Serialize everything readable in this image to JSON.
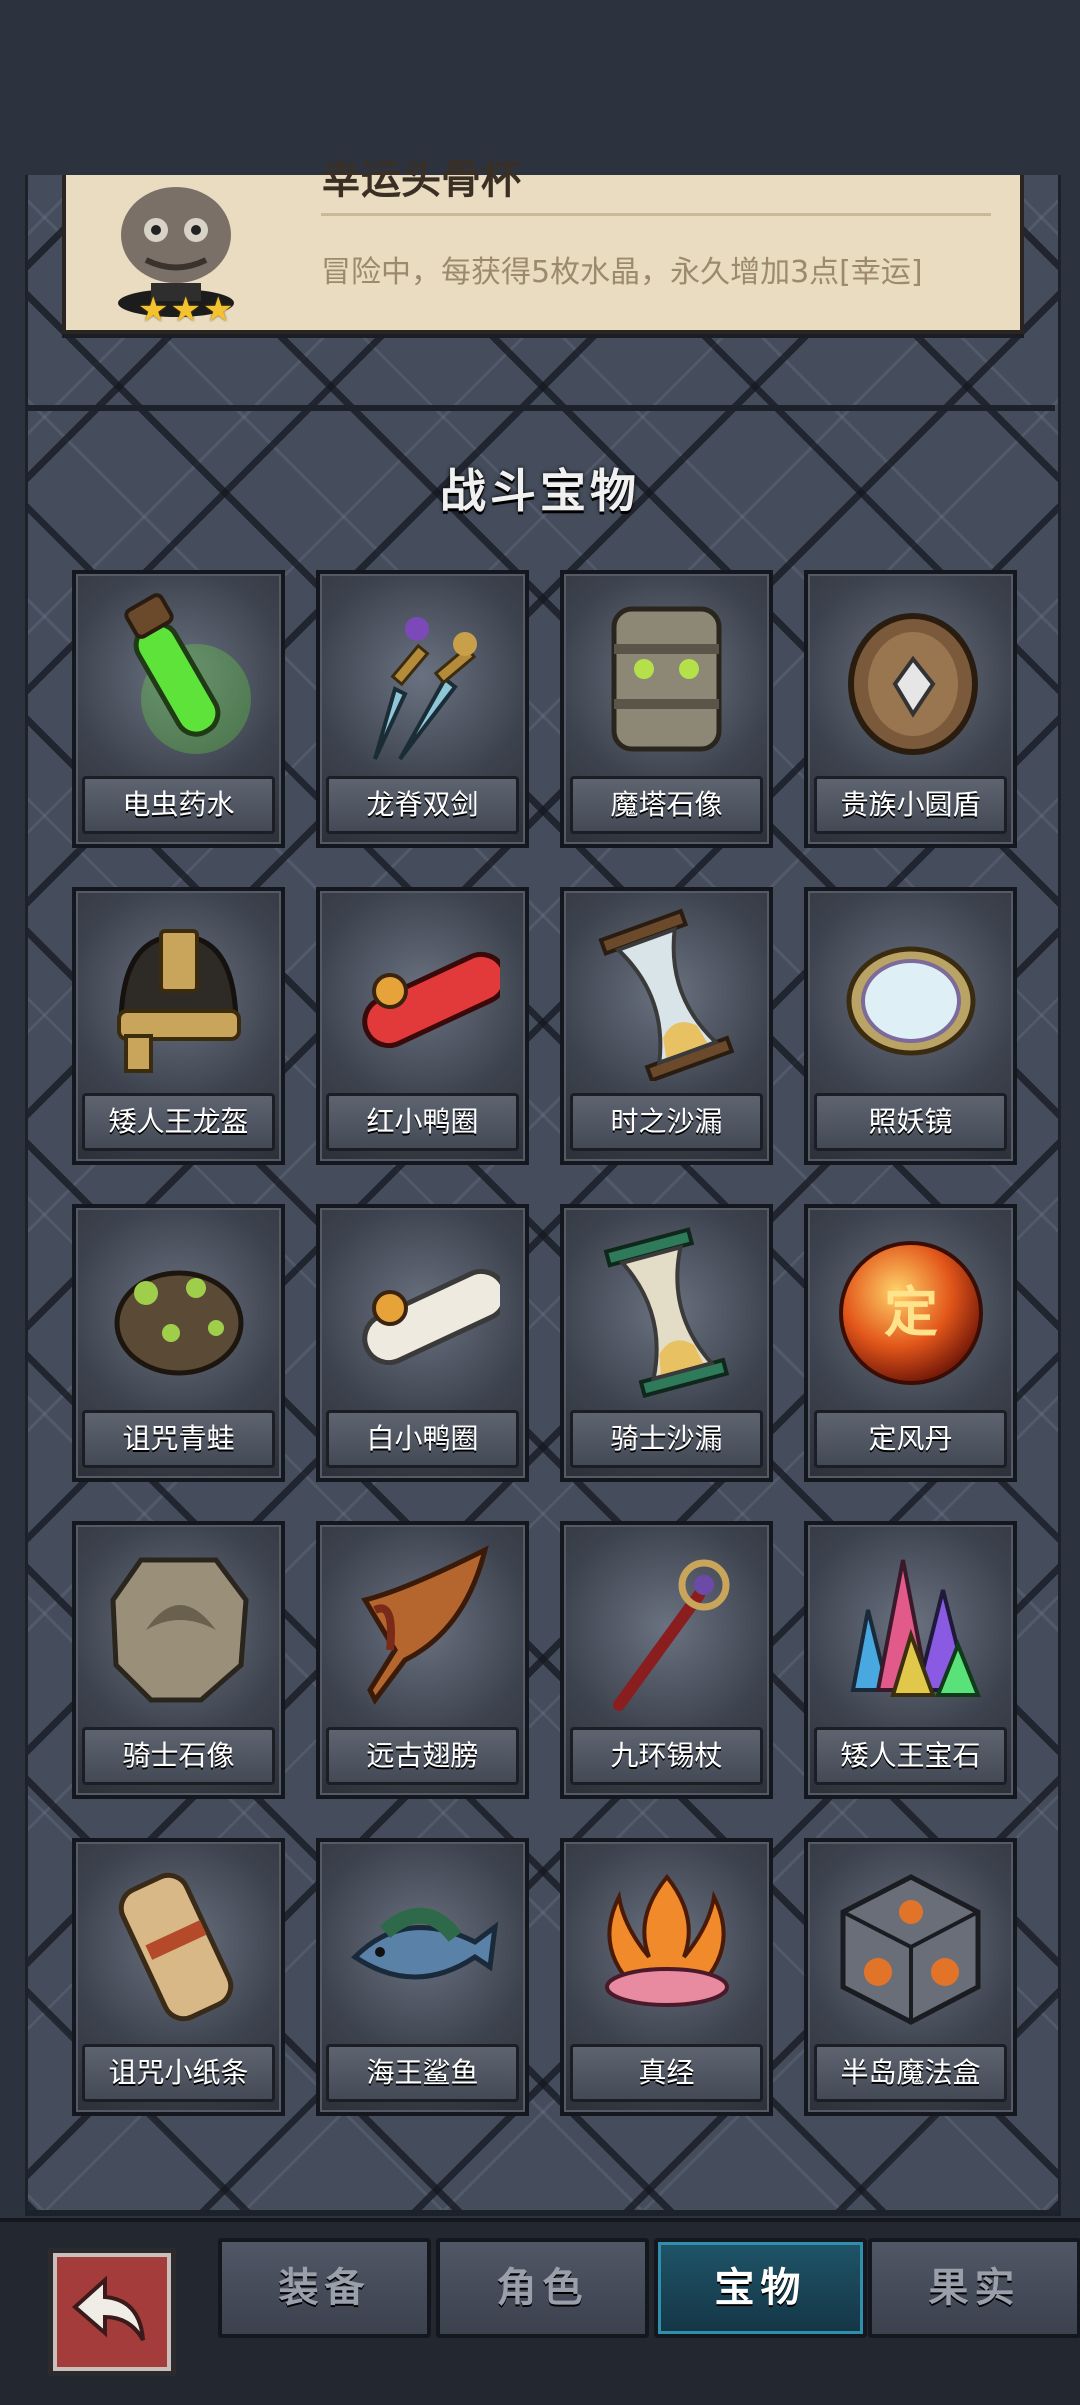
{
  "top_card": {
    "name": "幸运头骨杯",
    "description": "冒险中，每获得5枚水晶，永久增加3点[幸运]",
    "stars": "★★★"
  },
  "section_title": "战斗宝物",
  "items": [
    {
      "label": "电虫药水",
      "icon": "green-potion-icon"
    },
    {
      "label": "龙脊双剑",
      "icon": "twin-swords-icon"
    },
    {
      "label": "魔塔石像",
      "icon": "stone-totem-icon"
    },
    {
      "label": "贵族小圆盾",
      "icon": "round-shield-icon"
    },
    {
      "label": "矮人王龙盔",
      "icon": "dwarf-helmet-icon"
    },
    {
      "label": "红小鸭圈",
      "icon": "red-duck-ring-icon"
    },
    {
      "label": "时之沙漏",
      "icon": "hourglass-icon"
    },
    {
      "label": "照妖镜",
      "icon": "magic-mirror-icon"
    },
    {
      "label": "诅咒青蛙",
      "icon": "cursed-frog-icon"
    },
    {
      "label": "白小鸭圈",
      "icon": "white-duck-ring-icon"
    },
    {
      "label": "骑士沙漏",
      "icon": "knight-hourglass-icon"
    },
    {
      "label": "定风丹",
      "icon": "wind-orb-icon",
      "glyph": "定"
    },
    {
      "label": "骑士石像",
      "icon": "stone-tablet-icon"
    },
    {
      "label": "远古翅膀",
      "icon": "ancient-wing-icon"
    },
    {
      "label": "九环锡杖",
      "icon": "staff-icon"
    },
    {
      "label": "矮人王宝石",
      "icon": "crystal-cluster-icon"
    },
    {
      "label": "诅咒小纸条",
      "icon": "scroll-icon"
    },
    {
      "label": "海王鲨鱼",
      "icon": "shark-icon"
    },
    {
      "label": "真经",
      "icon": "lotus-flame-icon"
    },
    {
      "label": "半岛魔法盒",
      "icon": "magic-box-icon"
    }
  ],
  "tabs": [
    "装备",
    "角色",
    "宝物",
    "果实"
  ],
  "active_tab": "宝物",
  "colors": {
    "active_tab": "#1f5468",
    "back_button": "#a33c3a",
    "card": "#e9dcc0"
  }
}
